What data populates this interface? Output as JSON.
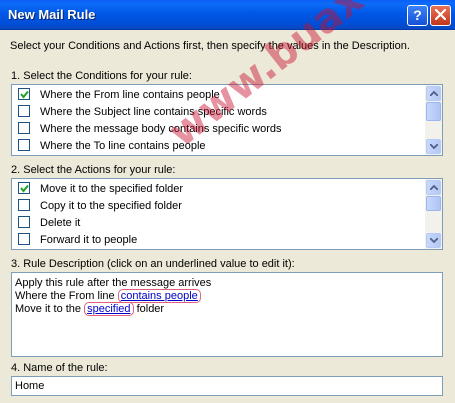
{
  "window": {
    "title": "New Mail Rule"
  },
  "intro": "Select your Conditions and Actions first, then specify the values in the Description.",
  "conditions": {
    "label": "1. Select the Conditions for your rule:",
    "items": [
      {
        "label": "Where the From line contains people",
        "checked": true
      },
      {
        "label": "Where the Subject line contains specific words",
        "checked": false
      },
      {
        "label": "Where the message body contains specific words",
        "checked": false
      },
      {
        "label": "Where the To line contains people",
        "checked": false
      }
    ]
  },
  "actions": {
    "label": "2. Select the Actions for your rule:",
    "items": [
      {
        "label": "Move it to the specified folder",
        "checked": true
      },
      {
        "label": "Copy it to the specified folder",
        "checked": false
      },
      {
        "label": "Delete it",
        "checked": false
      },
      {
        "label": "Forward it to people",
        "checked": false
      }
    ]
  },
  "description": {
    "label": "3. Rule Description (click on an underlined value to edit it):",
    "line1": "Apply this rule after the message arrives",
    "line2_prefix": "Where the From line ",
    "line2_link": "contains people",
    "line3_prefix": "Move it to the ",
    "line3_link": "specified",
    "line3_suffix": " folder"
  },
  "rule_name": {
    "label": "4. Name of the rule:",
    "value": "Home"
  },
  "watermark": "www.buaxua.vn",
  "colors": {
    "titlebar": "#0058e6",
    "link": "#0000cc",
    "watermark": "#c8102e"
  }
}
